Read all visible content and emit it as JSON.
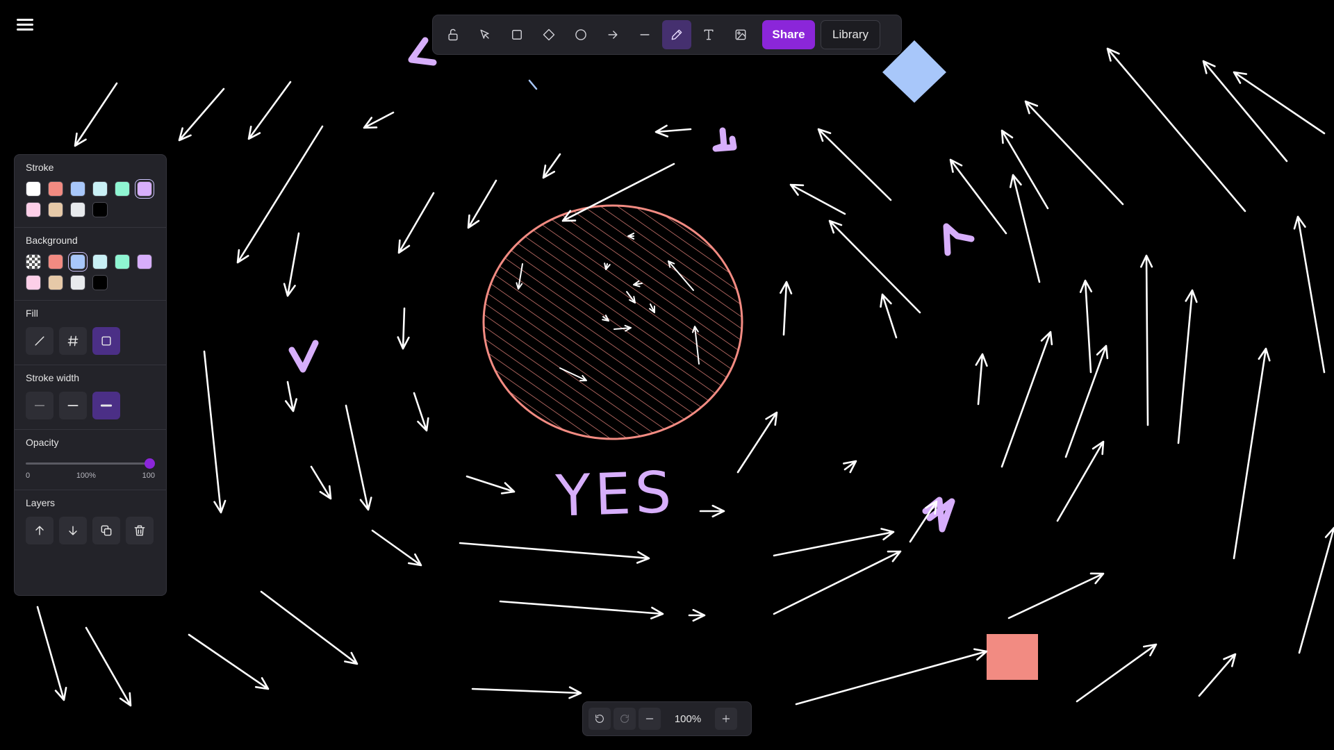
{
  "canvas": {
    "handwritten_text": "YES"
  },
  "toolbar": {
    "tools": [
      {
        "name": "lock",
        "icon": "lock-icon"
      },
      {
        "name": "selection",
        "icon": "cursor-icon"
      },
      {
        "name": "rectangle",
        "icon": "rectangle-icon"
      },
      {
        "name": "diamond",
        "icon": "diamond-icon"
      },
      {
        "name": "ellipse",
        "icon": "ellipse-icon"
      },
      {
        "name": "arrow",
        "icon": "arrow-icon"
      },
      {
        "name": "line",
        "icon": "line-icon"
      },
      {
        "name": "draw",
        "icon": "pencil-icon",
        "active": true
      },
      {
        "name": "text",
        "icon": "text-icon"
      },
      {
        "name": "image",
        "icon": "image-icon"
      }
    ],
    "share_label": "Share",
    "library_label": "Library"
  },
  "panel": {
    "stroke": {
      "title": "Stroke",
      "colors": [
        "#ffffff",
        "#f28b82",
        "#a8c7fa",
        "#c9f0f5",
        "#8ff5d2",
        "#d7aefb",
        "#fdcfe8",
        "#e6c9a8",
        "#e8eaed",
        "#000000"
      ],
      "selected": "#d7aefb"
    },
    "background": {
      "title": "Background",
      "colors": [
        "transparent",
        "#f28b82",
        "#a8c7fa",
        "#c9f0f5",
        "#8ff5d2",
        "#d7aefb",
        "#fdcfe8",
        "#e6c9a8",
        "#e8eaed",
        "#000000"
      ],
      "selected": "#a8c7fa"
    },
    "fill": {
      "title": "Fill",
      "options": [
        "hachure",
        "cross-hatch",
        "solid"
      ],
      "selected": "solid"
    },
    "stroke_width": {
      "title": "Stroke width",
      "options": [
        "thin",
        "bold",
        "extra-bold"
      ],
      "selected": "extra-bold"
    },
    "opacity": {
      "title": "Opacity",
      "value": 100,
      "min_label": "0",
      "mid_label": "100%",
      "max_label": "100"
    },
    "layers": {
      "title": "Layers",
      "actions": [
        "send-backward",
        "bring-forward",
        "duplicate",
        "delete"
      ]
    }
  },
  "zoom": {
    "level": "100%"
  },
  "colors": {
    "accent": "#8b26d9",
    "violet": "#d7aefb",
    "salmon": "#f28b82",
    "light_blue": "#a8c7fa",
    "white_stroke": "#ffffff"
  }
}
